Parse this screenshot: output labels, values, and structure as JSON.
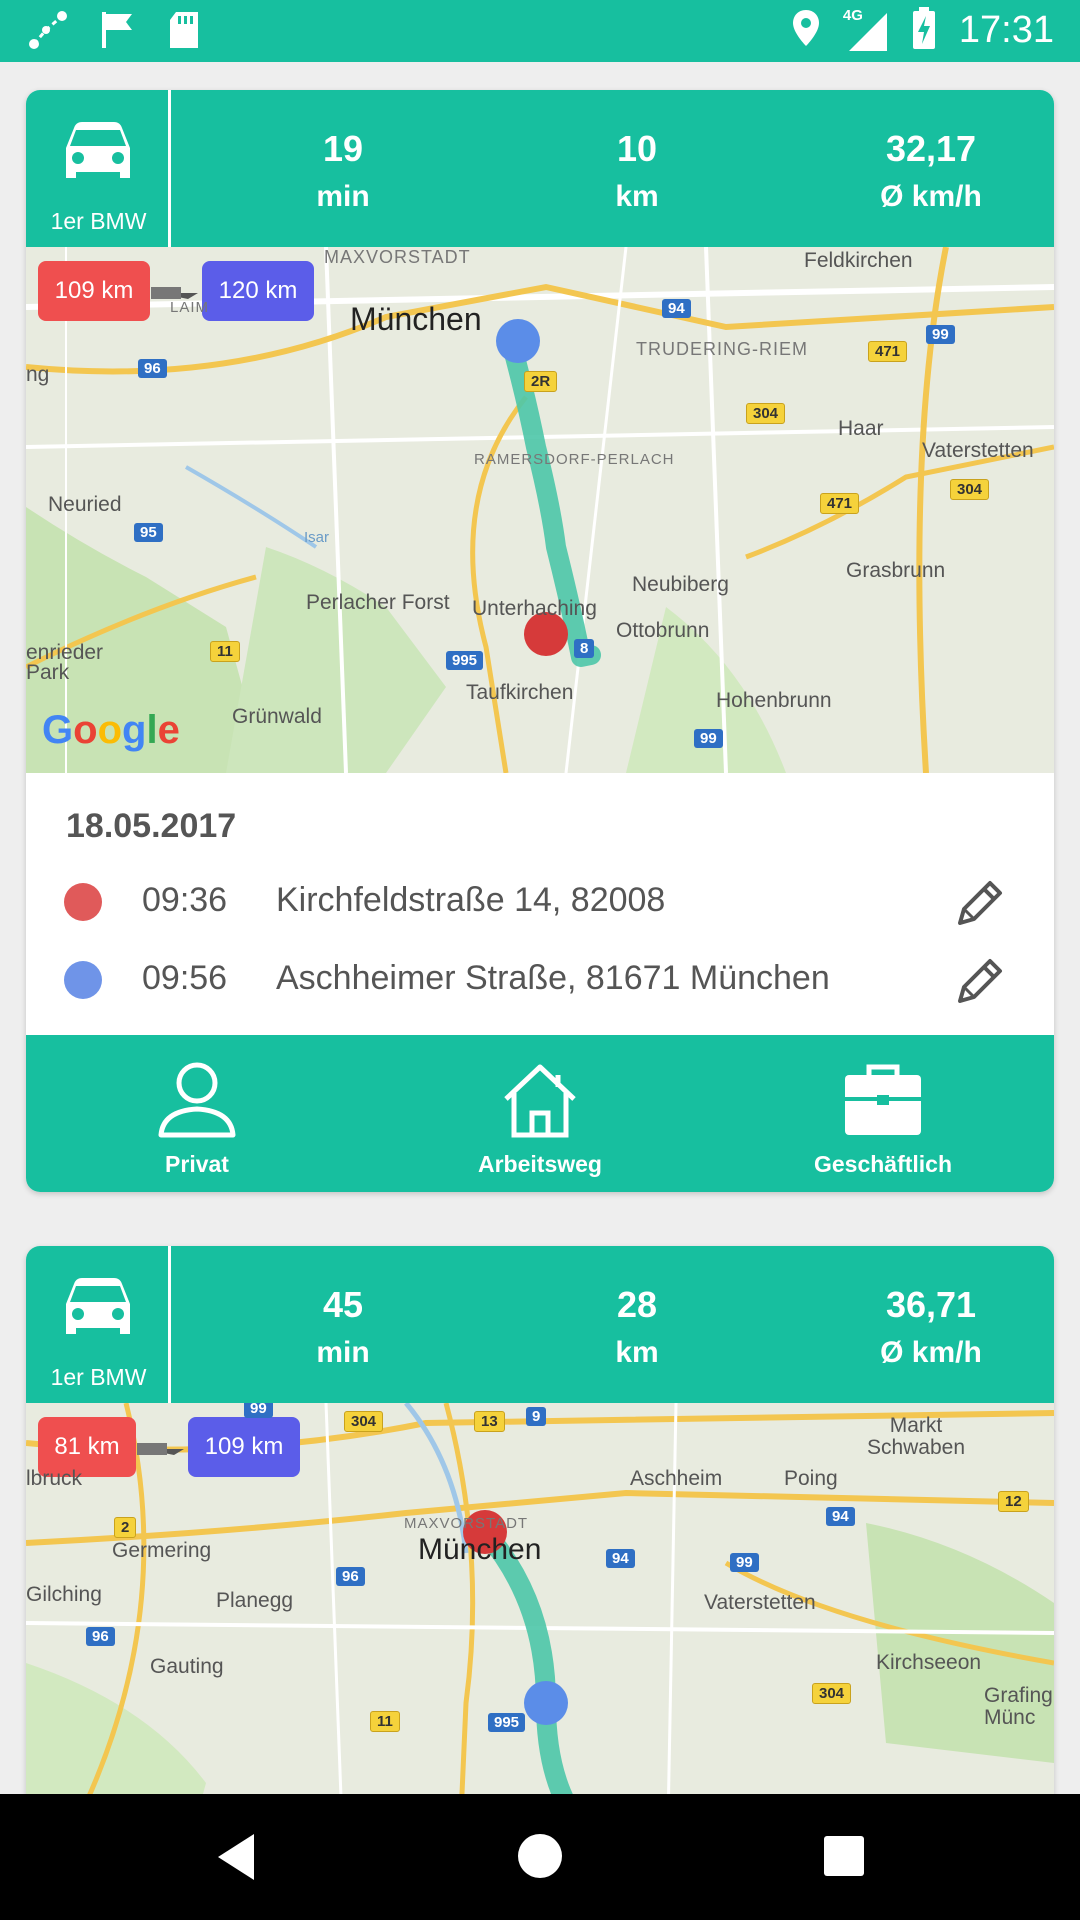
{
  "status_bar": {
    "time": "17:31",
    "network": "4G",
    "left_icons": [
      "route-icon",
      "flag-icon",
      "sd-card-icon"
    ],
    "right_icons": [
      "location-icon",
      "signal-icon",
      "battery-charging-icon"
    ]
  },
  "colors": {
    "primary": "#17bf9f",
    "start_dot": "#e05a5a",
    "end_dot": "#6f94e8",
    "chip_red": "#ef4f4f",
    "chip_blue": "#5b5de9"
  },
  "trips": [
    {
      "vehicle": "1er BMW",
      "duration": "19",
      "duration_unit": "min",
      "distance": "10",
      "distance_unit": "km",
      "speed": "32,17",
      "speed_unit": "Ø km/h",
      "odo_start": "109 km",
      "odo_end": "120 km",
      "map_labels": [
        "MAXVORSTADT",
        "München",
        "Feldkirchen",
        "TRUDERING-RIEM",
        "Haar",
        "Vaterstetten",
        "RAMERSDORF-PERLACH",
        "Neuried",
        "Neubiberg",
        "Grasbrunn",
        "Perlacher Forst",
        "Unterhaching",
        "Ottobrunn",
        "enrieder Park",
        "Taufkirchen",
        "Hohenbrunn",
        "Grünwald",
        "LAIM",
        "ng",
        "Isar"
      ],
      "date": "18.05.2017",
      "start_time": "09:36",
      "start_address": "Kirchfeldstraße 14, 82008",
      "end_time": "09:56",
      "end_address": "Aschheimer Straße, 81671 München",
      "purposes": [
        "Privat",
        "Arbeitsweg",
        "Geschäftlich"
      ],
      "selected_purpose": "Geschäftlich"
    },
    {
      "vehicle": "1er BMW",
      "duration": "45",
      "duration_unit": "min",
      "distance": "28",
      "distance_unit": "km",
      "speed": "36,71",
      "speed_unit": "Ø km/h",
      "odo_start": "81 km",
      "odo_end": "109 km",
      "map_labels": [
        "Markt Schwaben",
        "lbruck",
        "Aschheim",
        "Poing",
        "MAXVORSTADT",
        "München",
        "Germering",
        "Gilching",
        "Planegg",
        "Vaterstetten",
        "Gauting",
        "Kirchseeon",
        "Grafing Münc"
      ]
    }
  ],
  "google_logo": "Google"
}
